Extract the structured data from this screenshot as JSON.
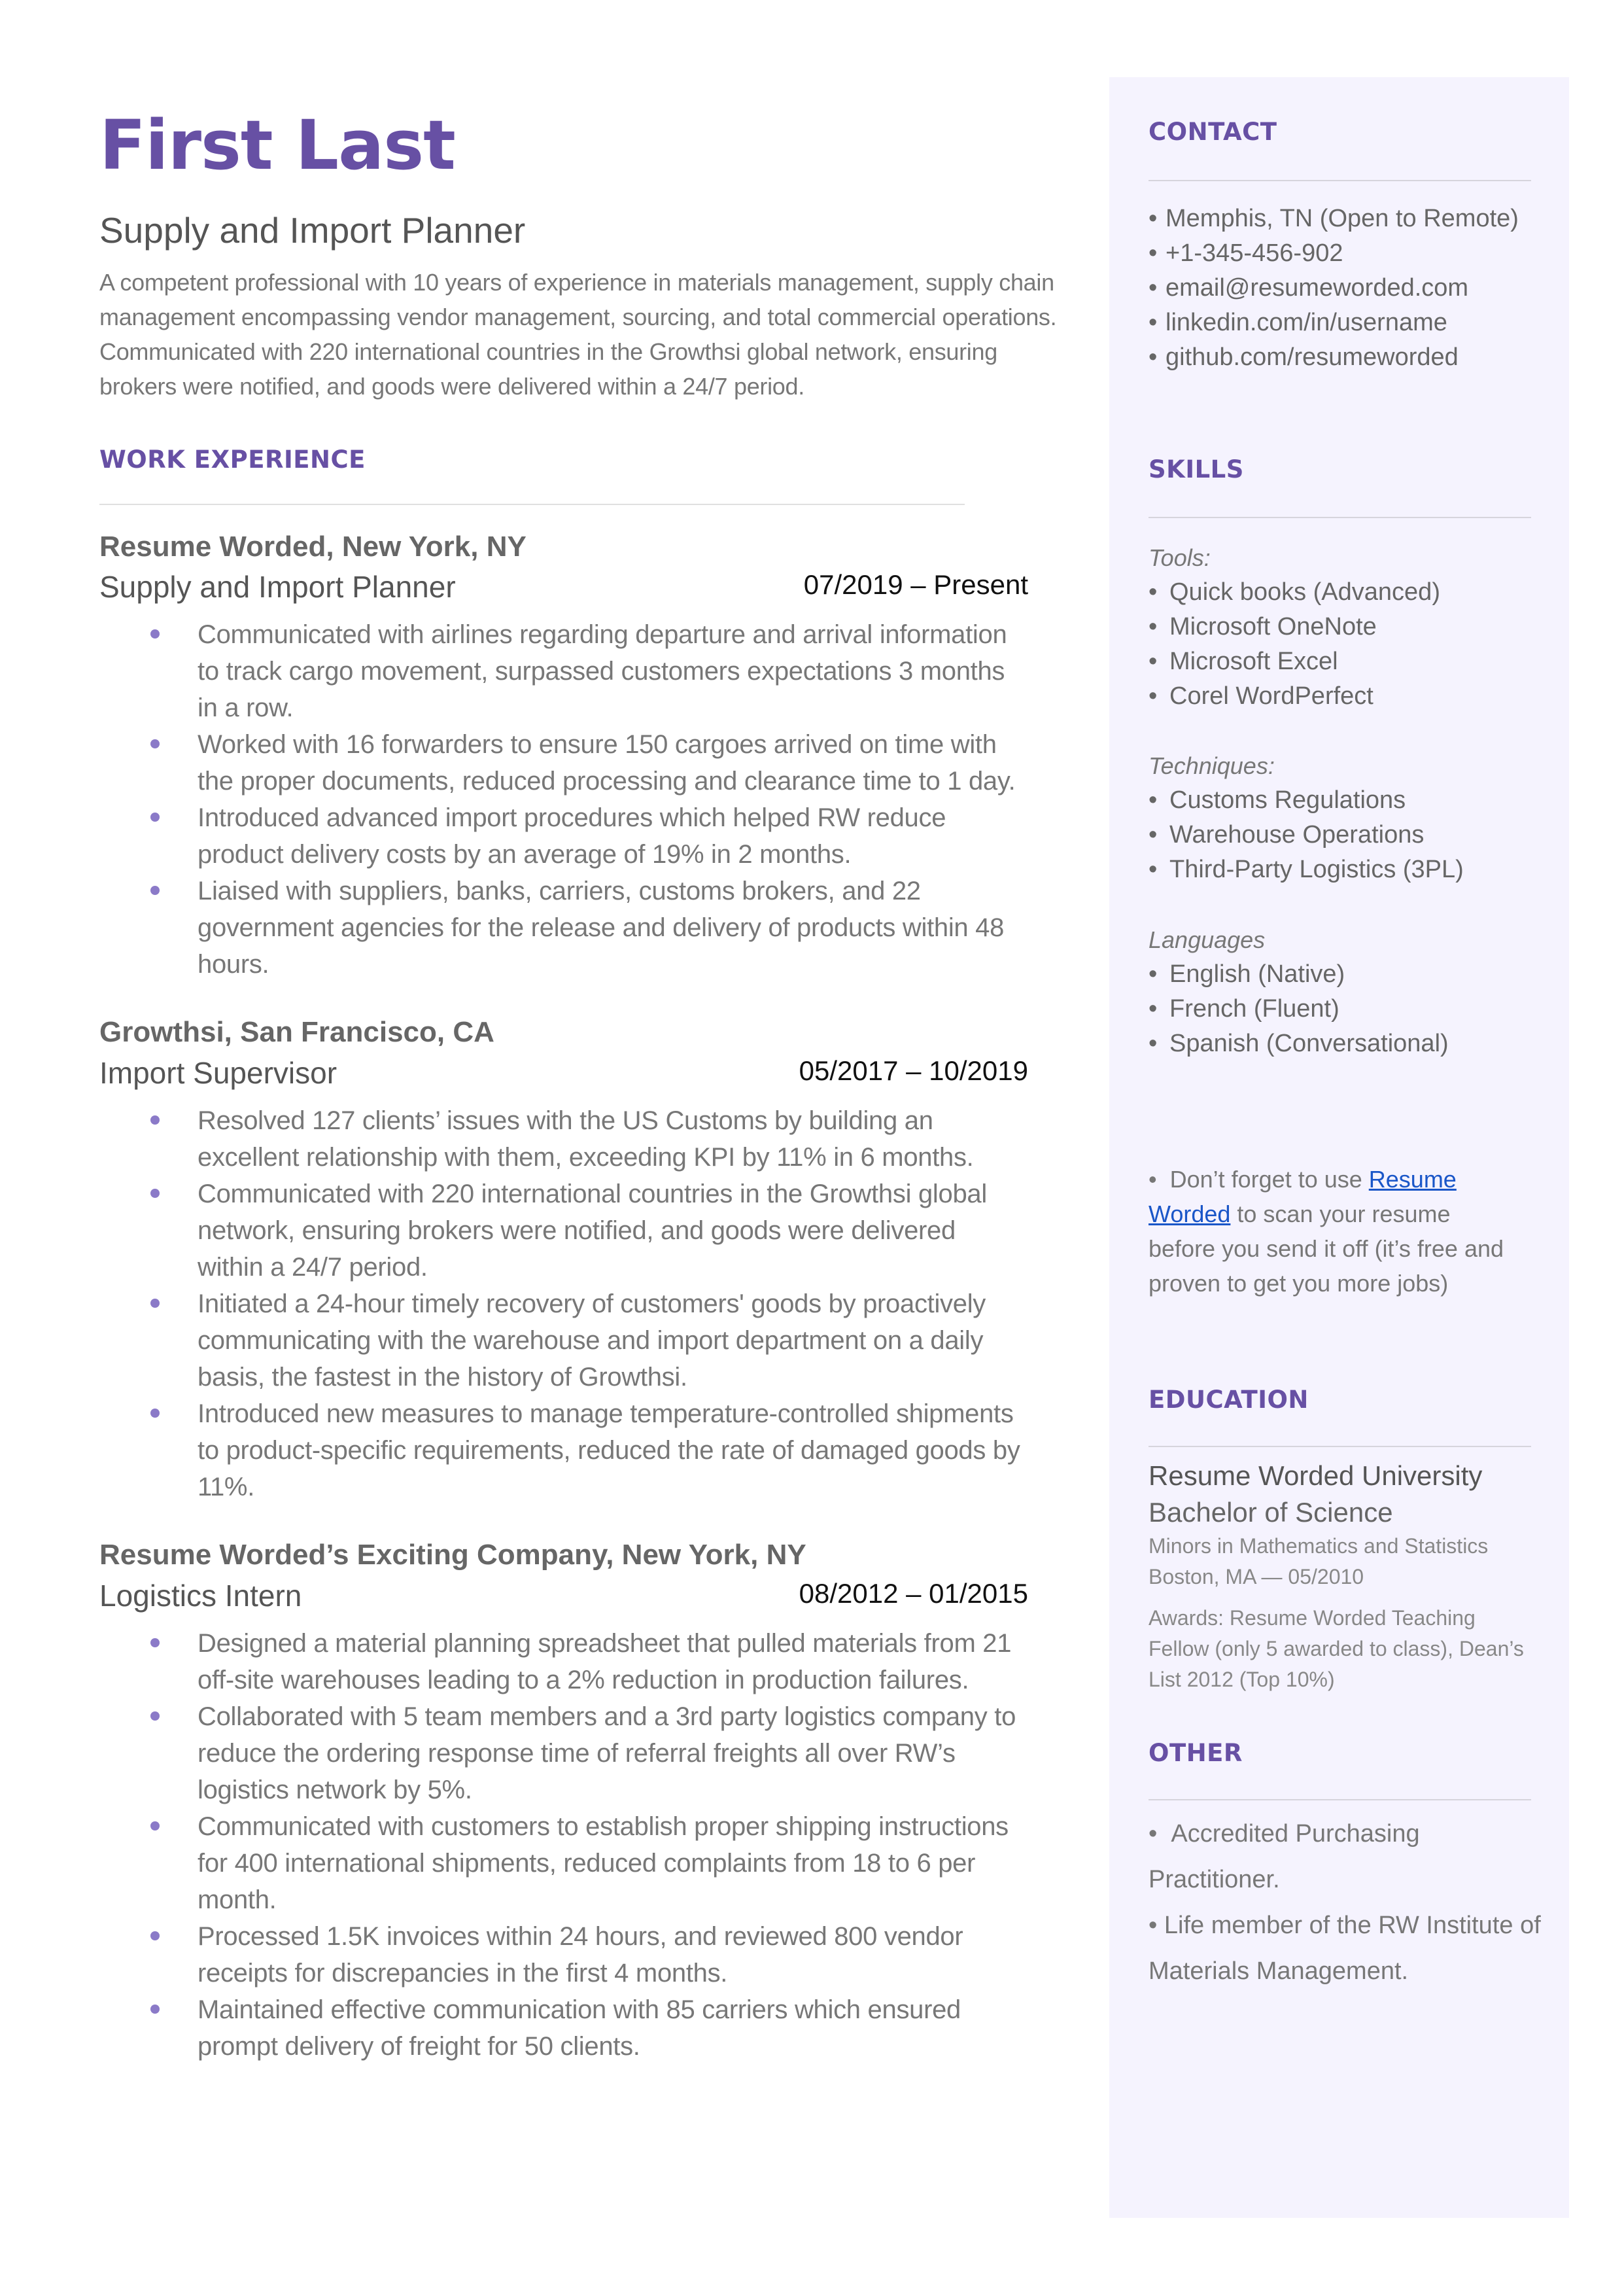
{
  "header": {
    "name": "First Last",
    "role": "Supply and Import Planner",
    "summary": "A competent professional with 10  years of experience in materials management, supply chain management encompassing vendor management, sourcing, and total commercial operations. Communicated with 220 international countries in the Growthsi global network, ensuring brokers were notified, and goods were delivered within a 24/7 period."
  },
  "work": {
    "heading": "WORK EXPERIENCE",
    "jobs": [
      {
        "company": "Resume Worded, New York, NY",
        "title": "Supply and Import Planner",
        "dates": "07/2019 – Present",
        "bullets": [
          "Communicated with airlines regarding departure and arrival information to track cargo movement, surpassed customers expectations 3 months in a row.",
          "Worked with 16 forwarders to ensure 150 cargoes arrived on time with the proper documents, reduced processing and clearance time to 1 day.",
          "Introduced advanced import procedures which helped RW reduce product delivery costs by an average of 19% in 2 months.",
          "Liaised with suppliers, banks, carriers, customs brokers, and 22 government agencies for the release and delivery of products within 48 hours."
        ]
      },
      {
        "company": "Growthsi, San Francisco, CA",
        "title": "Import Supervisor",
        "dates": "05/2017 – 10/2019",
        "bullets": [
          "Resolved 127 clients’ issues with the US Customs by building an excellent relationship with them, exceeding KPI by 11% in 6 months.",
          "Communicated with 220 international countries in the Growthsi global network, ensuring brokers were notified, and goods were delivered within a 24/7 period.",
          "Initiated a 24-hour timely recovery of customers' goods by proactively communicating with the warehouse and import department on a daily basis, the fastest in the history of Growthsi.",
          "Introduced new measures to manage temperature-controlled shipments to product-specific requirements, reduced the rate of damaged goods by 11%."
        ]
      },
      {
        "company": "Resume Worded’s Exciting Company, New York, NY",
        "title": "Logistics Intern",
        "dates": "08/2012 – 01/2015",
        "bullets": [
          "Designed a material planning spreadsheet that pulled materials from 21 off-site warehouses leading to a 2% reduction in production failures.",
          "Collaborated with 5 team members and a 3rd party logistics company to reduce the ordering response time of referral freights all over RW’s logistics network by 5%.",
          "Communicated with customers to establish proper shipping instructions for 400 international shipments, reduced complaints from 18 to 6 per month.",
          "Processed 1.5K invoices within 24 hours, and reviewed 800 vendor receipts for discrepancies in the first 4 months.",
          "Maintained effective communication with 85 carriers which ensured prompt delivery of freight for 50 clients."
        ]
      }
    ]
  },
  "sidebar": {
    "contact": {
      "heading": "CONTACT",
      "items": [
        "Memphis, TN (Open to Remote)",
        "+1-345-456-902",
        "email@resumeworded.com",
        "linkedin.com/in/username",
        "github.com/resumeworded"
      ]
    },
    "skills": {
      "heading": "SKILLS",
      "groups": [
        {
          "label": "Tools:",
          "items": [
            "Quick books (Advanced)",
            "Microsoft OneNote",
            "Microsoft Excel",
            "Corel WordPerfect"
          ]
        },
        {
          "label": "Techniques:",
          "items": [
            "Customs Regulations",
            "Warehouse Operations",
            "Third-Party Logistics (3PL)"
          ]
        },
        {
          "label": "Languages",
          "items": [
            "English (Native)",
            "French (Fluent)",
            "Spanish (Conversational)"
          ]
        }
      ]
    },
    "tip": {
      "prefix": "Don’t forget to use ",
      "link": "Resume Worded",
      "suffix": " to scan your resume before you send it off (it’s free and proven to get you more jobs)"
    },
    "education": {
      "heading": "EDUCATION",
      "school": "Resume Worded University",
      "degree": "Bachelor of Science",
      "minors": "Minors in Mathematics and Statistics",
      "location_date": "Boston, MA — 05/2010",
      "awards": "Awards: Resume Worded Teaching Fellow (only 5 awarded to class), Dean’s List 2012 (Top 10%)"
    },
    "other": {
      "heading": "OTHER",
      "items": [
        "Accredited Purchasing Practitioner.",
        "Life member of the RW Institute of Materials Management."
      ]
    }
  },
  "colors": {
    "accent": "#6750A4",
    "bullet": "#8B7AC8",
    "sidebar_bg": "#F5F3FE",
    "link": "#1a56c8"
  }
}
